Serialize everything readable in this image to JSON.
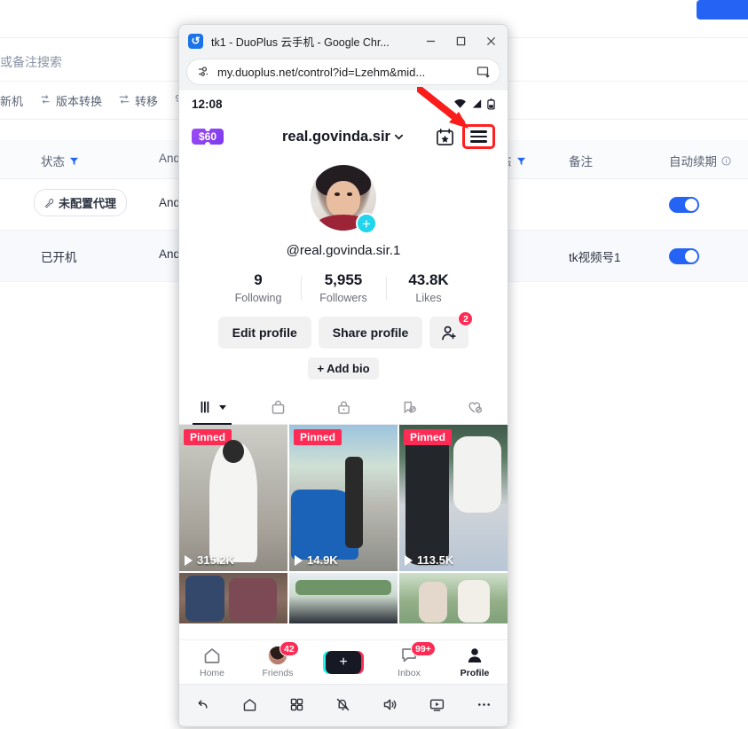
{
  "background_page": {
    "search_placeholder_fragment": "或备注搜索",
    "toolbar_items": [
      {
        "label": "新机",
        "icon": "device-icon"
      },
      {
        "label": "版本转换",
        "icon": "version-swap-icon"
      },
      {
        "label": "转移",
        "icon": "transfer-icon"
      },
      {
        "label": "",
        "icon": "share-icon"
      }
    ],
    "table": {
      "headers": [
        {
          "label": "状态",
          "has_filter": true
        },
        {
          "label": "And",
          "has_filter": false
        },
        {
          "label": "态",
          "has_filter": true
        },
        {
          "label": "备注",
          "has_filter": false
        },
        {
          "label": "自动续期",
          "has_info": true
        }
      ],
      "rows": [
        {
          "status": "未配置代理",
          "status_type": "chip",
          "android": "And",
          "note": "",
          "auto_renew": true
        },
        {
          "status": "已开机",
          "status_type": "text",
          "android": "And",
          "note": "tk视频号1",
          "auto_renew": true
        }
      ]
    },
    "accent_blue": "#2563f5"
  },
  "chrome": {
    "window_title": "tk1 - DuoPlus 云手机 - Google Chr...",
    "favicon": "duoplus-icon",
    "minimize_label": "minimize",
    "maximize_label": "maximize",
    "close_label": "close",
    "url": "my.duoplus.net/control?id=Lzehm&mid...",
    "site_info_icon": "site-settings-icon",
    "cast_icon": "install-app-icon"
  },
  "phone": {
    "status_bar": {
      "time": "12:08",
      "icons": [
        "wifi-icon",
        "signal-icon",
        "battery-icon"
      ]
    },
    "header": {
      "coupon_label": "$60",
      "username": "real.govinda.sir",
      "dropdown_icon": "chevron-down-icon",
      "calendar_icon": "calendar-star-icon",
      "menu_icon": "hamburger-menu-icon",
      "menu_highlight_color": "#ff1f1f"
    },
    "profile": {
      "handle": "@real.govinda.sir.1",
      "avatar_add_icon": "plus-circle-icon",
      "avatar_add_color": "#20d5ec",
      "stats": [
        {
          "value": "9",
          "label": "Following"
        },
        {
          "value": "5,955",
          "label": "Followers"
        },
        {
          "value": "43.8K",
          "label": "Likes"
        }
      ],
      "edit_profile_label": "Edit profile",
      "share_profile_label": "Share profile",
      "add_friend_icon": "add-person-icon",
      "add_friend_badge": "2",
      "add_bio_label": "+ Add bio"
    },
    "tabs": [
      {
        "icon": "grid-posts-icon",
        "active": true,
        "has_caret": true
      },
      {
        "icon": "shopping-bag-icon",
        "active": false
      },
      {
        "icon": "lock-private-icon",
        "active": false
      },
      {
        "icon": "bookmark-off-icon",
        "active": false
      },
      {
        "icon": "heart-off-icon",
        "active": false
      }
    ],
    "videos": [
      {
        "pinned_label": "Pinned",
        "views": "315.2K",
        "thumb": "t1"
      },
      {
        "pinned_label": "Pinned",
        "views": "14.9K",
        "thumb": "t2"
      },
      {
        "pinned_label": "Pinned",
        "views": "113.5K",
        "thumb": "t3"
      },
      {
        "pinned_label": "",
        "views": "",
        "thumb": "t4"
      },
      {
        "pinned_label": "",
        "views": "",
        "thumb": "t5"
      },
      {
        "pinned_label": "",
        "views": "",
        "thumb": "t6"
      }
    ],
    "bottom_nav": [
      {
        "label": "Home",
        "icon": "home-icon",
        "active": false,
        "badge": ""
      },
      {
        "label": "Friends",
        "icon": "friends-avatar-icon",
        "active": false,
        "badge": "42"
      },
      {
        "label": "",
        "icon": "create-plus-icon",
        "active": false,
        "badge": ""
      },
      {
        "label": "Inbox",
        "icon": "inbox-icon",
        "active": false,
        "badge": "99+"
      },
      {
        "label": "Profile",
        "icon": "profile-person-icon",
        "active": true,
        "badge": ""
      }
    ],
    "android_bar": [
      {
        "icon": "back-icon"
      },
      {
        "icon": "home-icon"
      },
      {
        "icon": "apps-grid-icon"
      },
      {
        "icon": "mute-notification-icon"
      },
      {
        "icon": "volume-icon"
      },
      {
        "icon": "screen-record-icon"
      },
      {
        "icon": "more-dots-icon"
      }
    ],
    "badge_color": "#fe2c55"
  }
}
